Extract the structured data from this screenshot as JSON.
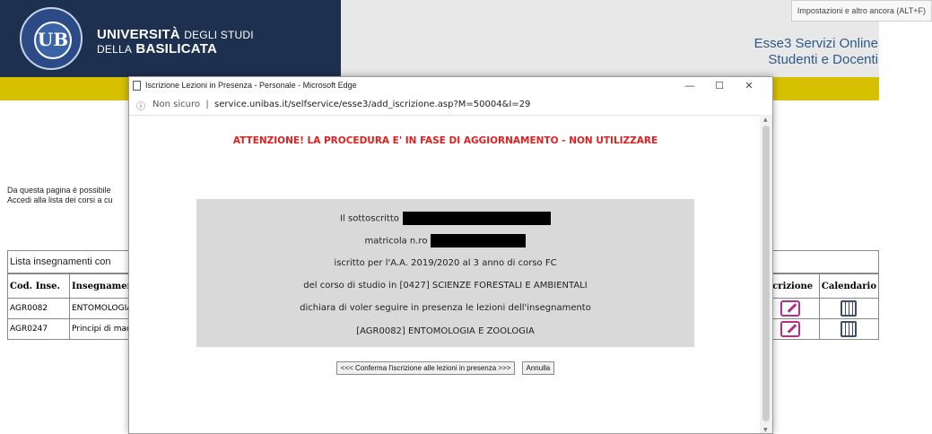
{
  "header": {
    "uni_line1_bold": "UNIVERSITÀ",
    "uni_line1_light": "DEGLI STUDI",
    "uni_line2_light": "DELLA",
    "uni_line2_bold": "BASILICATA",
    "service_line1": "Esse3 Servizi Online",
    "service_line2": "Studenti e Docenti",
    "seal_letter": "UB"
  },
  "tooltip": "Impostazioni e altro ancora (ALT+F)",
  "intro": {
    "line1": "Da questa pagina è possibile",
    "line2": "Accedi alla lista dei corsi a cu"
  },
  "list_title": "Lista insegnamenti con",
  "table": {
    "headers": [
      "Cod. Inse.",
      "Insegnament",
      "Iscrizione",
      "Calendario"
    ],
    "rows": [
      {
        "code": "AGR0082",
        "name": "ENTOMOLOGIA"
      },
      {
        "code": "AGR0247",
        "name": "Principi di mac"
      }
    ]
  },
  "popup": {
    "title": "Iscrizione Lezioni in Presenza - Personale - Microsoft Edge",
    "addr_info_icon": "ⓘ",
    "addr_not_secure": "Non sicuro",
    "addr_sep": "|",
    "url": "service.unibas.it/selfservice/esse3/add_iscrizione.asp?M=50004&I=29",
    "warning": "ATTENZIONE! LA PROCEDURA E' IN FASE DI AGGIORNAMENTO - NON UTILIZZARE",
    "box": {
      "line1": "Il sottoscritto",
      "line2": "matricola n.ro",
      "line3": "iscritto per l'A.A. 2019/2020 al 3 anno di corso FC",
      "line4": "del corso di studio in [0427] SCIENZE FORESTALI E AMBIENTALI",
      "line5": "dichiara di voler seguire in presenza le lezioni dell'insegnamento",
      "line6": "[AGR0082] ENTOMOLOGIA E ZOOLOGIA"
    },
    "confirm_label": "<<< Conferma l'iscrizione alle lezioni in presenza >>>",
    "cancel_label": "Annulla",
    "btn_min": "—",
    "btn_max": "☐",
    "btn_close": "✕"
  },
  "colors": {
    "navy": "#1e3050",
    "yellow": "#d7c000",
    "warning": "#e02020",
    "link_blue": "#2d5a8a"
  }
}
